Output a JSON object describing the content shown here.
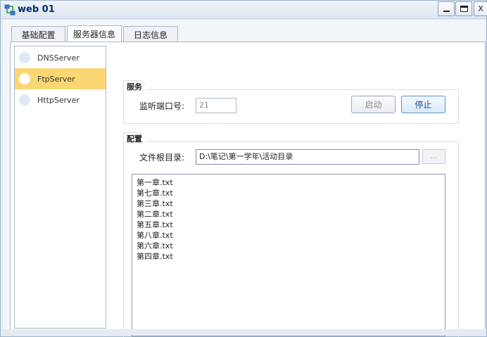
{
  "window": {
    "title": "web 01",
    "close_label": "X",
    "icon": "network-app-icon"
  },
  "tabs": [
    {
      "label": "基础配置",
      "active": false
    },
    {
      "label": "服务器信息",
      "active": true
    },
    {
      "label": "日志信息",
      "active": false
    }
  ],
  "servers": [
    {
      "label": "DNSServer",
      "selected": false
    },
    {
      "label": "FtpServer",
      "selected": true
    },
    {
      "label": "HttpServer",
      "selected": false
    }
  ],
  "service": {
    "group_title": "服务",
    "port_label": "监听端口号:",
    "port_value": "21",
    "start_label": "启动",
    "stop_label": "停止"
  },
  "config": {
    "group_title": "配置",
    "root_label": "文件根目录:",
    "root_value": "D:\\笔记\\第一学年\\活动目录",
    "browse_label": "...",
    "files": [
      "第一章.txt",
      "第七章.txt",
      "第三章.txt",
      "第二章.txt",
      "第五章.txt",
      "第八章.txt",
      "第六章.txt",
      "第四章.txt"
    ]
  },
  "colors": {
    "selected_item": "#fbd774",
    "dot_unselected": "#dfe8f4",
    "dot_selected": "#ffffff",
    "title_text": "#0b2a6b"
  }
}
